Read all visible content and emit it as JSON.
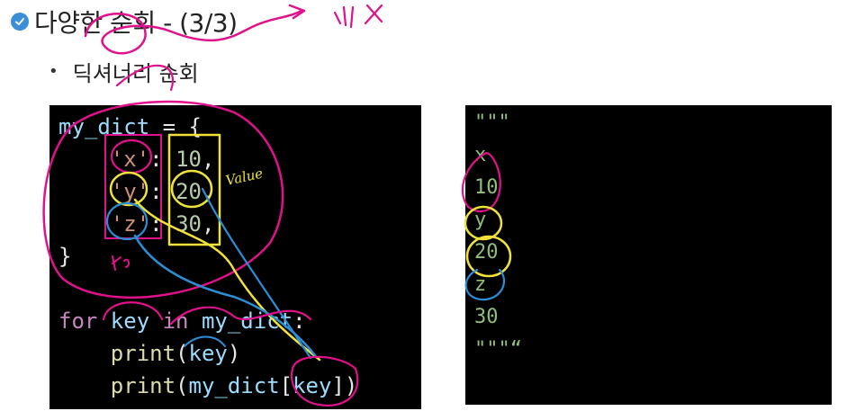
{
  "header": {
    "title": "다양한 순회 - (3/3)",
    "icon": "check-circle-icon",
    "accent": "#3b8fd9"
  },
  "bullet": {
    "text": "딕셔너리 순회"
  },
  "code": {
    "lines": [
      [
        {
          "t": "my_dict",
          "c": "var"
        },
        {
          "t": " = {",
          "c": "op"
        }
      ],
      [
        {
          "t": "    ",
          "c": "op"
        },
        {
          "t": "'x'",
          "c": "str"
        },
        {
          "t": ": ",
          "c": "op"
        },
        {
          "t": "10",
          "c": "num"
        },
        {
          "t": ",",
          "c": "op"
        }
      ],
      [
        {
          "t": "    ",
          "c": "op"
        },
        {
          "t": "'y'",
          "c": "str"
        },
        {
          "t": ": ",
          "c": "op"
        },
        {
          "t": "20",
          "c": "num"
        },
        {
          "t": ",",
          "c": "op"
        }
      ],
      [
        {
          "t": "    ",
          "c": "op"
        },
        {
          "t": "'z'",
          "c": "str"
        },
        {
          "t": ": ",
          "c": "op"
        },
        {
          "t": "30",
          "c": "num"
        },
        {
          "t": ",",
          "c": "op"
        }
      ],
      [
        {
          "t": "}",
          "c": "op"
        }
      ],
      [
        {
          "t": " ",
          "c": "op"
        }
      ],
      [
        {
          "t": "for ",
          "c": "kw"
        },
        {
          "t": "key",
          "c": "var"
        },
        {
          "t": " in ",
          "c": "kw"
        },
        {
          "t": "my_dict",
          "c": "var"
        },
        {
          "t": ":",
          "c": "op"
        }
      ],
      [
        {
          "t": "    ",
          "c": "op"
        },
        {
          "t": "print",
          "c": "fn"
        },
        {
          "t": "(",
          "c": "op"
        },
        {
          "t": "key",
          "c": "var"
        },
        {
          "t": ")",
          "c": "op"
        }
      ],
      [
        {
          "t": "    ",
          "c": "op"
        },
        {
          "t": "print",
          "c": "fn"
        },
        {
          "t": "(",
          "c": "op"
        },
        {
          "t": "my_dict",
          "c": "var"
        },
        {
          "t": "[",
          "c": "op"
        },
        {
          "t": "key",
          "c": "var"
        },
        {
          "t": "])",
          "c": "op"
        }
      ]
    ]
  },
  "output": {
    "lines": [
      "\"\"\"",
      "x",
      "10",
      "y",
      "20",
      "z",
      "30",
      "\"\"\"“"
    ]
  },
  "annotations": {
    "top_note": "~> 생 X",
    "value_note": "Value",
    "key_note": "Key"
  }
}
